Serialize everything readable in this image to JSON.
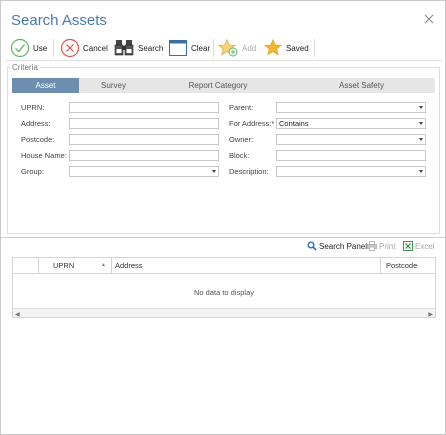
{
  "window": {
    "title": "Search Assets"
  },
  "toolbar": {
    "use_label": "Use",
    "cancel_label": "Cancel",
    "search_label": "Search",
    "clear_label": "Clear",
    "add_label": "Add",
    "saved_label": "Saved"
  },
  "criteria": {
    "legend": "Criteria",
    "tabs": [
      "Asset",
      "Survey",
      "Report Category",
      "Asset Safety"
    ],
    "active_tab": "Asset",
    "left_fields": [
      {
        "label": "UPRN:",
        "value": ""
      },
      {
        "label": "Address:",
        "value": ""
      },
      {
        "label": "Postcode:",
        "value": ""
      },
      {
        "label": "House Name:",
        "value": ""
      },
      {
        "label": "Group:",
        "value": ""
      }
    ],
    "right_fields": [
      {
        "label": "Parent:",
        "value": ""
      },
      {
        "label": "For Address:*",
        "value": "Contains"
      },
      {
        "label": "Owner:",
        "value": ""
      },
      {
        "label": "Block:",
        "value": ""
      },
      {
        "label": "Description:",
        "value": ""
      }
    ]
  },
  "grid_toolbar": {
    "search_panel_label": "Search Panel",
    "print_label": "Print",
    "excel_label": "Excel"
  },
  "grid": {
    "columns": [
      "UPRN",
      "Address",
      "Postcode"
    ],
    "sort_indicator": "▲",
    "empty_text": "No data to display"
  },
  "colors": {
    "title": "#4a7bb0",
    "active_tab": "#6e8eb0",
    "use_green": "#5cb85c",
    "cancel_red": "#e05050",
    "star_gold": "#f2b632",
    "search_blue": "#2a6ebb",
    "excel_green": "#2e8b3e"
  }
}
